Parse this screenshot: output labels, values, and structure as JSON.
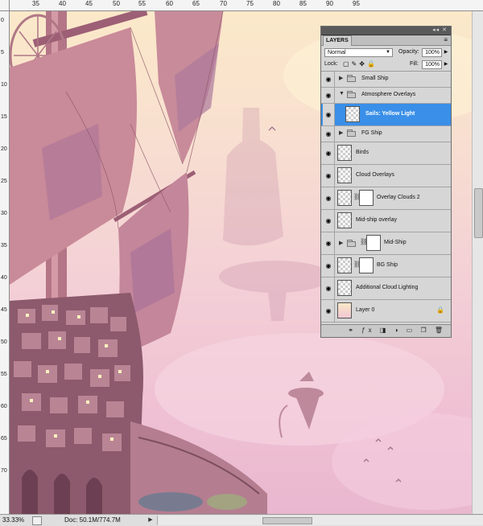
{
  "ruler": {
    "top_labels": [
      "35",
      "40",
      "45",
      "50",
      "55",
      "60",
      "65",
      "70",
      "75",
      "80",
      "85",
      "90",
      "95"
    ],
    "left_labels": [
      "0",
      "5",
      "10",
      "15",
      "20",
      "25",
      "30",
      "35",
      "40",
      "45",
      "50",
      "55",
      "60",
      "65",
      "70"
    ]
  },
  "status": {
    "zoom": "33.33%",
    "doc": "Doc: 50.1M/774.7M"
  },
  "panel": {
    "tab": "LAYERS",
    "blend_mode": "Normal",
    "opacity_label": "Opacity:",
    "opacity_value": "100%",
    "lock_label": "Lock:",
    "fill_label": "Fill:",
    "fill_value": "100%",
    "layers": [
      {
        "name": "Small Ship",
        "kind": "group",
        "expanded": false
      },
      {
        "name": "Atmosphere Overlays",
        "kind": "group",
        "expanded": true
      },
      {
        "name": "Sails: Yellow Light",
        "kind": "layer",
        "selected": true
      },
      {
        "name": "FG Ship",
        "kind": "group",
        "expanded": false
      },
      {
        "name": "Birds",
        "kind": "layer"
      },
      {
        "name": "Cloud Overlays",
        "kind": "layer"
      },
      {
        "name": "Overlay Clouds 2",
        "kind": "layer",
        "mask": true
      },
      {
        "name": "Mid-ship overlay",
        "kind": "layer"
      },
      {
        "name": "Mid-Ship",
        "kind": "group",
        "mask": true
      },
      {
        "name": "BG Ship",
        "kind": "layer",
        "mask": true
      },
      {
        "name": "Additional Cloud Lighting",
        "kind": "layer"
      },
      {
        "name": "Layer 0",
        "kind": "layer",
        "locked": true
      }
    ]
  },
  "icons": {
    "eye": "eye-icon",
    "lock": "lock-icon",
    "folder": "folder-icon",
    "chain": "link-icon"
  },
  "colors": {
    "selection": "#3a8fe8",
    "panel_bg": "#d6d6d6"
  }
}
